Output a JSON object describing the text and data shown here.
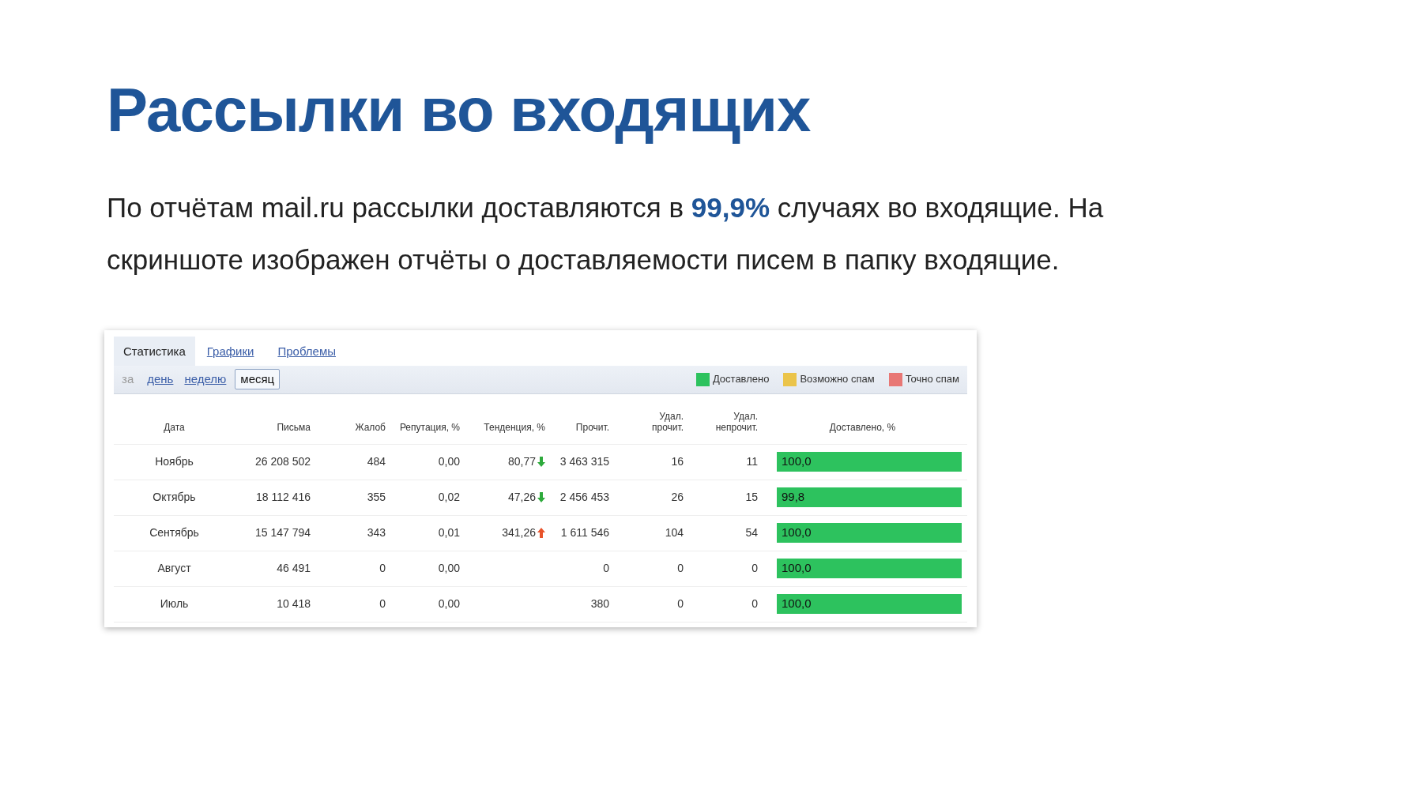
{
  "title": "Рассылки во входящих",
  "paragraph": "По отчётам mail.ru рассылки доставляются в **99,9%** случаях во входящие. На скриншоте изображен отчёты о доставляемости писем в папку входящие.",
  "report": {
    "tabs": [
      {
        "label": "Статистика",
        "selected": true
      },
      {
        "label": "Графики",
        "selected": false
      },
      {
        "label": "Проблемы",
        "selected": false
      }
    ],
    "period_label": "за",
    "periods": [
      {
        "label": "день",
        "selected": false
      },
      {
        "label": "неделю",
        "selected": false
      },
      {
        "label": "месяц",
        "selected": true
      }
    ],
    "legend": [
      {
        "label": "Доставлено",
        "color": "#2dc25e"
      },
      {
        "label": "Возможно спам",
        "color": "#ebc44a"
      },
      {
        "label": "Точно спам",
        "color": "#e87775"
      }
    ],
    "columns": [
      "Дата",
      "Письма",
      "Жалоб",
      "Репутация, %",
      "Тенденция, %",
      "Прочит.",
      "Удал. прочит.",
      "Удал. непрочит.",
      "Доставлено, %"
    ],
    "rows": [
      {
        "date": "Ноябрь",
        "letters": "26 208 502",
        "complaints": "484",
        "reputation": "0,00",
        "trend": {
          "value": "80,77",
          "kind": "down"
        },
        "read": "3 463 315",
        "deleted_read": "16",
        "deleted_unread": "11",
        "delivered": "100,0"
      },
      {
        "date": "Октябрь",
        "letters": "18 112 416",
        "complaints": "355",
        "reputation": "0,02",
        "trend": {
          "value": "47,26",
          "kind": "down"
        },
        "read": "2 456 453",
        "deleted_read": "26",
        "deleted_unread": "15",
        "delivered": "99,8"
      },
      {
        "date": "Сентябрь",
        "letters": "15 147 794",
        "complaints": "343",
        "reputation": "0,01",
        "trend": {
          "value": "341,26",
          "kind": "up"
        },
        "read": "1 611 546",
        "deleted_read": "104",
        "deleted_unread": "54",
        "delivered": "100,0"
      },
      {
        "date": "Август",
        "letters": "46 491",
        "complaints": "0",
        "reputation": "0,00",
        "read": "0",
        "deleted_read": "0",
        "deleted_unread": "0",
        "delivered": "100,0"
      },
      {
        "date": "Июль",
        "letters": "10 418",
        "complaints": "0",
        "reputation": "0,00",
        "read": "380",
        "deleted_read": "0",
        "deleted_unread": "0",
        "delivered": "100,0"
      }
    ]
  }
}
